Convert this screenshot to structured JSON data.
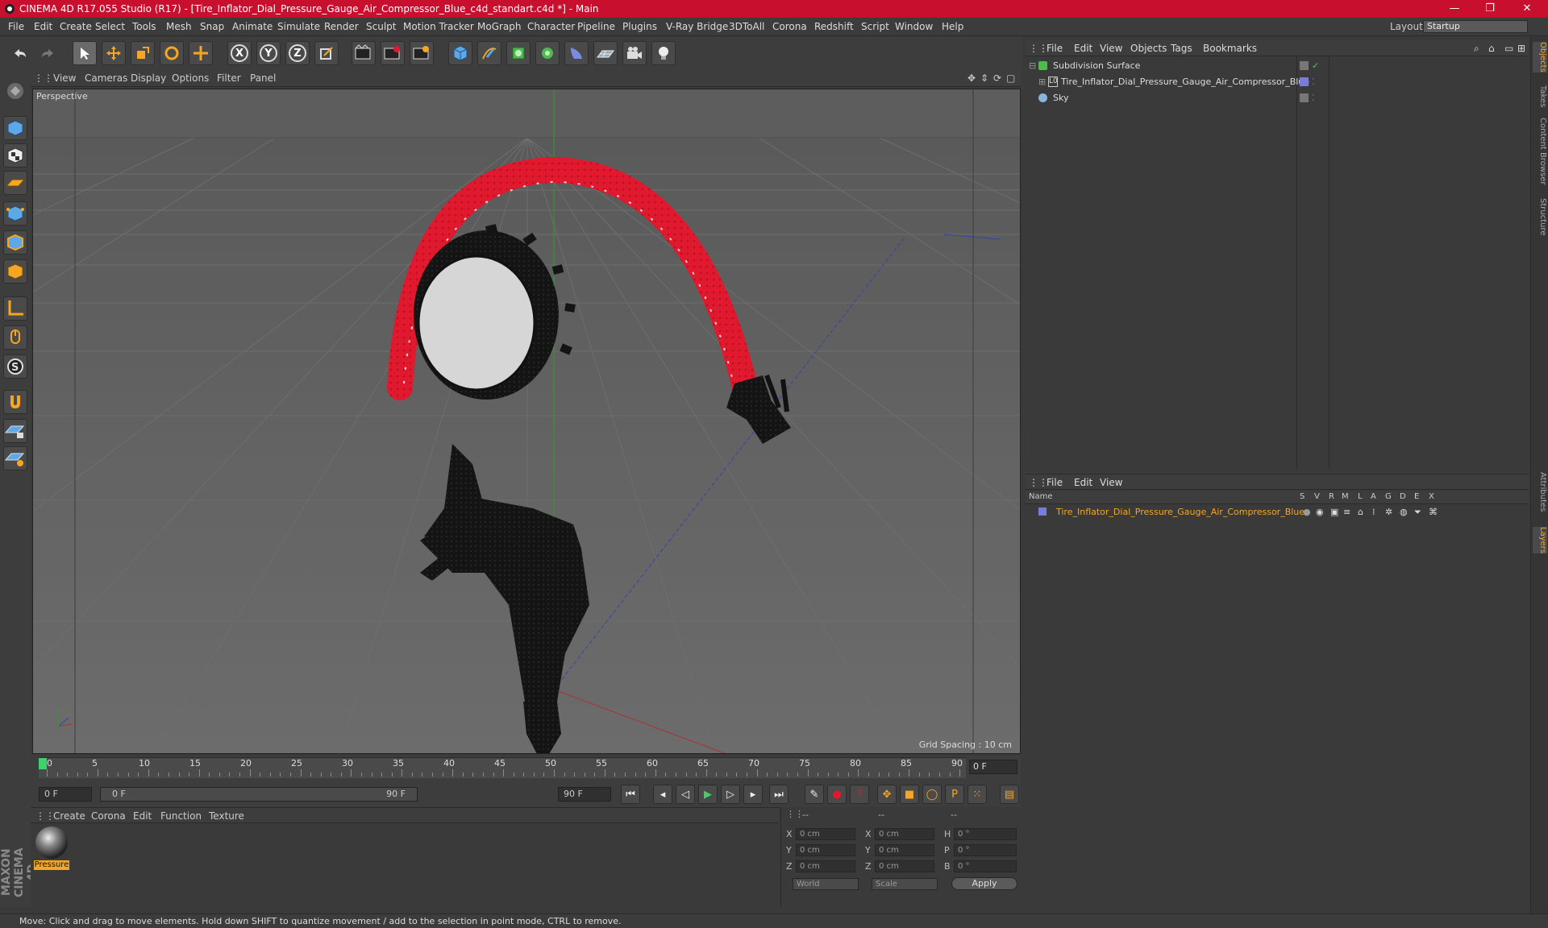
{
  "title_bar": {
    "title": "CINEMA 4D R17.055 Studio (R17) - [Tire_Inflator_Dial_Pressure_Gauge_Air_Compressor_Blue_c4d_standart.c4d *] - Main",
    "minimize": "—",
    "maximize": "❐",
    "close": "✕"
  },
  "menu": [
    "File",
    "Edit",
    "Create",
    "Select",
    "Tools",
    "Mesh",
    "Snap",
    "Animate",
    "Simulate",
    "Render",
    "Sculpt",
    "Motion Tracker",
    "MoGraph",
    "Character",
    "Pipeline",
    "Plugins",
    "V-Ray Bridge",
    "3DToAll",
    "Corona",
    "Redshift",
    "Script",
    "Window",
    "Help"
  ],
  "layout": {
    "label": "Layout:",
    "value": "Startup"
  },
  "toolbar": {
    "axis_x": "X",
    "axis_y": "Y",
    "axis_z": "Z"
  },
  "viewport": {
    "menu": [
      "View",
      "Cameras",
      "Display",
      "Options",
      "Filter",
      "Panel"
    ],
    "camera_label": "Perspective",
    "grid_spacing": "Grid Spacing : 10 cm"
  },
  "timeline": {
    "ticks": [
      "0",
      "5",
      "10",
      "15",
      "20",
      "25",
      "30",
      "35",
      "40",
      "45",
      "50",
      "55",
      "60",
      "65",
      "70",
      "75",
      "80",
      "85",
      "90"
    ],
    "current_frame": "0 F",
    "start_field": "0 F",
    "range_start": "0 F",
    "range_end": "90 F",
    "end_field": "90 F"
  },
  "material_manager": {
    "menu": [
      "Create",
      "Corona",
      "Edit",
      "Function",
      "Texture"
    ],
    "material_name": "Pressure"
  },
  "coordinates": {
    "headers": [
      "--",
      "--",
      "--"
    ],
    "rows": [
      {
        "axis": "X",
        "pos": "0 cm",
        "axis2": "X",
        "size": "0 cm",
        "rot_label": "H",
        "rot": "0 °"
      },
      {
        "axis": "Y",
        "pos": "0 cm",
        "axis2": "Y",
        "size": "0 cm",
        "rot_label": "P",
        "rot": "0 °"
      },
      {
        "axis": "Z",
        "pos": "0 cm",
        "axis2": "Z",
        "size": "0 cm",
        "rot_label": "B",
        "rot": "0 °"
      }
    ],
    "mode": "World",
    "scale_mode": "Scale",
    "apply": "Apply"
  },
  "branding": "MAXON CINEMA 4D",
  "status": "Move: Click and drag to move elements. Hold down SHIFT to quantize movement / add to the selection in point mode, CTRL to remove.",
  "object_manager": {
    "menu": [
      "File",
      "Edit",
      "View",
      "Objects",
      "Tags",
      "Bookmarks"
    ],
    "objects": [
      {
        "name": "Subdivision Surface"
      },
      {
        "name": "Tire_Inflator_Dial_Pressure_Gauge_Air_Compressor_Blue"
      },
      {
        "name": "Sky"
      }
    ]
  },
  "layer_manager": {
    "menu": [
      "File",
      "Edit",
      "View"
    ],
    "columns": [
      "Name",
      "S",
      "V",
      "R",
      "M",
      "L",
      "A",
      "G",
      "D",
      "E",
      "X"
    ],
    "layer_name": "Tire_Inflator_Dial_Pressure_Gauge_Air_Compressor_Blue"
  },
  "right_tabs": [
    "Objects",
    "Takes",
    "Content Browser",
    "Structure",
    "Attributes",
    "Layers"
  ],
  "colors": {
    "title_bar": "#c8102e",
    "hose": "#e0192e",
    "accent_orange": "#f5a623"
  }
}
